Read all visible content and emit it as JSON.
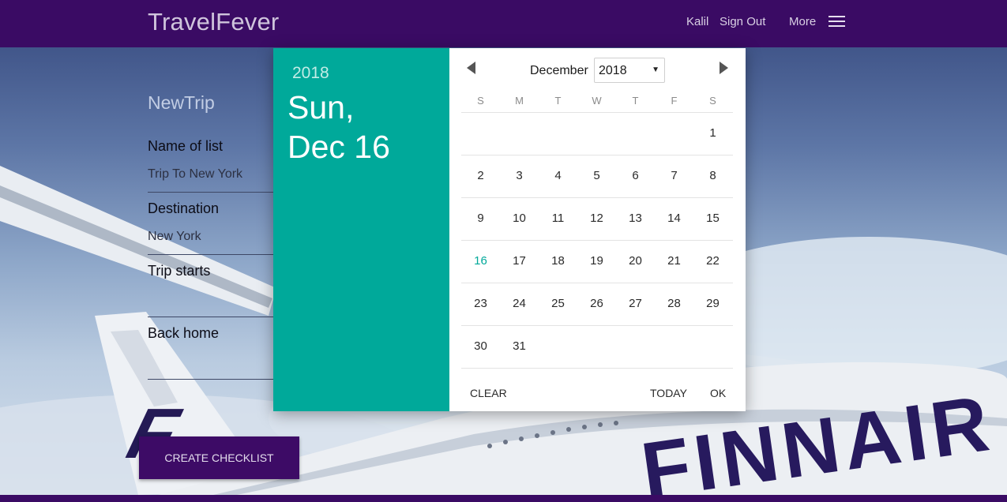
{
  "navbar": {
    "brand": "TravelFever",
    "user": "Kalil",
    "sign_out": "Sign Out",
    "more": "More"
  },
  "form": {
    "title": "NewTrip",
    "fields": [
      {
        "label": "Name of list",
        "value": "Trip To New York"
      },
      {
        "label": "Destination",
        "value": "New York"
      },
      {
        "label": "Trip starts",
        "value": ""
      },
      {
        "label": "Back home",
        "value": ""
      }
    ],
    "create_button": "CREATE CHECKLIST"
  },
  "background": {
    "tail_logo": "F",
    "fuselage_text": "FINNAIR"
  },
  "datepicker": {
    "header_year": "2018",
    "header_weekday": "Sun,",
    "header_date": "Dec 16",
    "month": "December",
    "year": "2018",
    "weekdays": [
      "S",
      "M",
      "T",
      "W",
      "T",
      "F",
      "S"
    ],
    "days": [
      "1",
      "2",
      "3",
      "4",
      "5",
      "6",
      "7",
      "8",
      "9",
      "10",
      "11",
      "12",
      "13",
      "14",
      "15",
      "16",
      "17",
      "18",
      "19",
      "20",
      "21",
      "22",
      "23",
      "24",
      "25",
      "26",
      "27",
      "28",
      "29",
      "30",
      "31"
    ],
    "selected_day": "16",
    "actions": {
      "clear": "CLEAR",
      "today": "TODAY",
      "ok": "OK"
    }
  },
  "colors": {
    "navbar": "#3a0b64",
    "picker_accent": "#00a99a",
    "button": "#3d0b66"
  },
  "icons": {
    "menu": "hamburger-icon",
    "prev": "prev-month-arrow-icon",
    "next": "next-month-arrow-icon"
  }
}
